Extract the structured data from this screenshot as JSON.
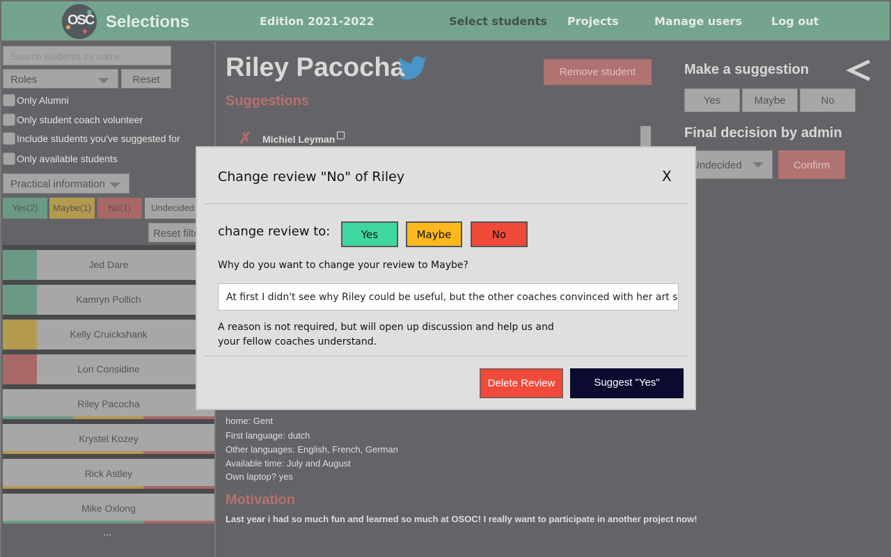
{
  "header": {
    "brand": "Selections",
    "logo_text": "OSC",
    "edition": "Edition 2021-2022",
    "nav": [
      "Select students",
      "Projects",
      "Manage users",
      "Log out"
    ]
  },
  "sidebar": {
    "search_placeholder": "Search students by name",
    "roles_label": "Roles",
    "reset_label": "Reset",
    "checkboxes": [
      "Only Alumni",
      "Only student coach volunteer",
      "Include students you've suggested for",
      "Only available students"
    ],
    "practical_info": "Practical information",
    "chips": [
      "Yes(2)",
      "Maybe(1)",
      "No(1)",
      "Undecided"
    ],
    "reset_filters": "Reset filters",
    "students": [
      "Jed Dare",
      "Kamryn Pollich",
      "Kelly Cruickshank",
      "Lon Considine",
      "Riley Pacocha",
      "Krystel Kozey",
      "Rick Astley",
      "Mike Oxlong"
    ],
    "more": "..."
  },
  "main": {
    "student_name": "Riley Pacocha",
    "remove_label": "Remove student",
    "suggestions_title": "Suggestions",
    "suggestion_author": "Michiel Leyman",
    "info": [
      "home: Gent",
      "First language: dutch",
      "Other languages: English, French, German",
      "Available time: July and August",
      "Own laptop? yes"
    ],
    "motivation_title": "Motivation",
    "motivation_text": "Last year i had so much fun and learned so much at OSOC! I really want to participate in another project now!"
  },
  "right": {
    "make_suggestion": "Make a suggestion",
    "buttons": [
      "Yes",
      "Maybe",
      "No"
    ],
    "final_decision": "Final decision by admin",
    "decision_value": "Undecided",
    "confirm_label": "Confirm"
  },
  "modal": {
    "title": "Change review \"No\" of Riley",
    "close": "X",
    "change_to": "change review to:",
    "options": [
      "Yes",
      "Maybe",
      "No"
    ],
    "why": "Why do you want to change your review to Maybe?",
    "reason_value": "At first I didn't see why Riley could be useful, but the other coaches convinced with her art skills!",
    "hint": "A  reason is not required, but will open up discussion and help us and your fellow coaches understand.",
    "delete_label": "Delete Review",
    "suggest_label": "Suggest \"Yes\""
  },
  "colors": {
    "yes": "#3fd7a0",
    "maybe": "#fdb81e",
    "no": "#f04a3a",
    "header_green": "#74a38e",
    "suggest_dark": "#0b0b30"
  }
}
